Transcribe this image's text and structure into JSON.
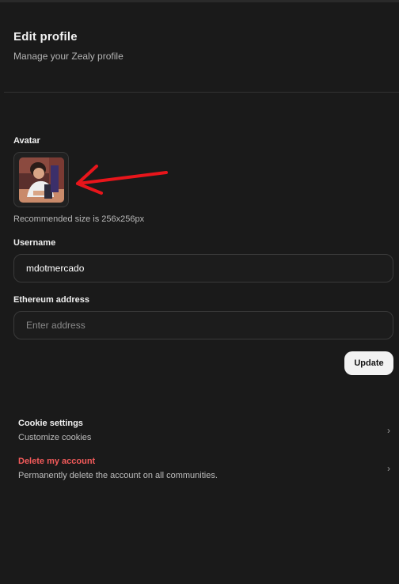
{
  "header": {
    "title": "Edit profile",
    "subtitle": "Manage your Zealy profile"
  },
  "avatar": {
    "label": "Avatar",
    "hint": "Recommended size is 256x256px",
    "annotation_color": "#e8151b"
  },
  "username": {
    "label": "Username",
    "value": "mdotmercado"
  },
  "ethereum": {
    "label": "Ethereum address",
    "value": "",
    "placeholder": "Enter address"
  },
  "actions": {
    "update_label": "Update"
  },
  "settings": [
    {
      "title": "Cookie settings",
      "description": "Customize cookies",
      "icon": "chevron-right-icon"
    },
    {
      "title": "Delete my account",
      "description": "Permanently delete the account on all communities.",
      "icon": "chevron-right-icon",
      "color": "#f45b5b"
    }
  ]
}
